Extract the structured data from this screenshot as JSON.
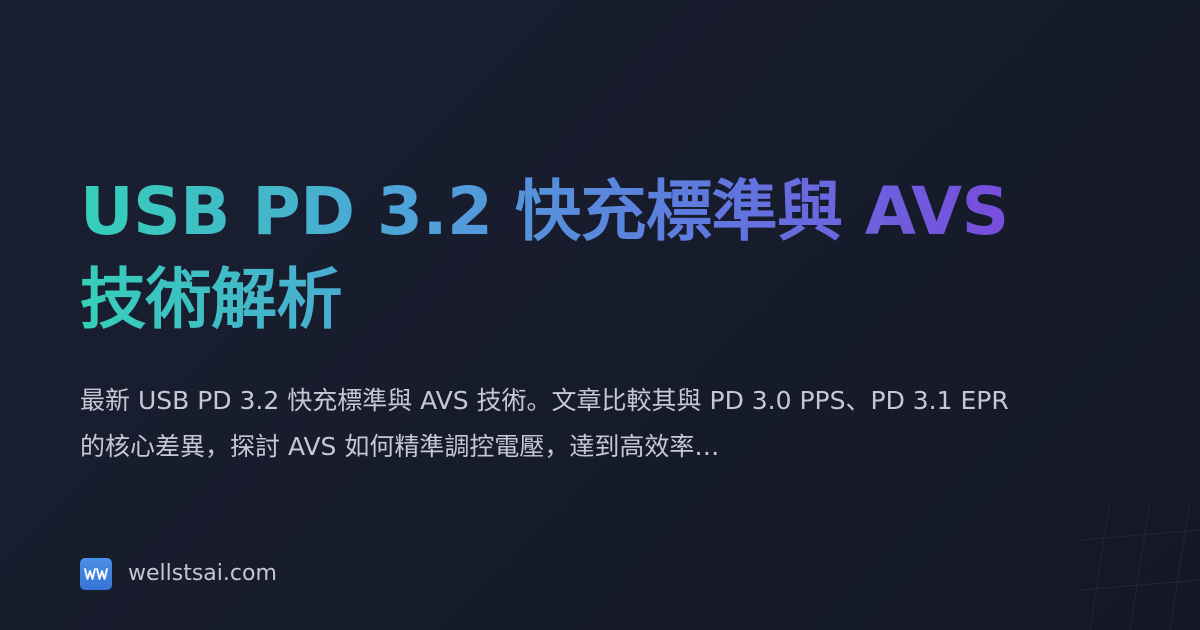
{
  "card": {
    "title": "USB PD 3.2 快充標準與 AVS 技術解析",
    "description": "最新 USB PD 3.2 快充標準與 AVS 技術。文章比較其與 PD 3.0 PPS、PD 3.1 EPR 的核心差異，探討 AVS 如何精準調控電壓，達到高效率…",
    "site": "wellstsai.com",
    "logo_icon": "ww-logo-icon",
    "colors": {
      "background": "#171c2c",
      "title_gradient_start": "#35d0b8",
      "title_gradient_end": "#7b48dc",
      "description_text": "#c5c9d4",
      "logo_bg": "#3f82e0"
    }
  }
}
